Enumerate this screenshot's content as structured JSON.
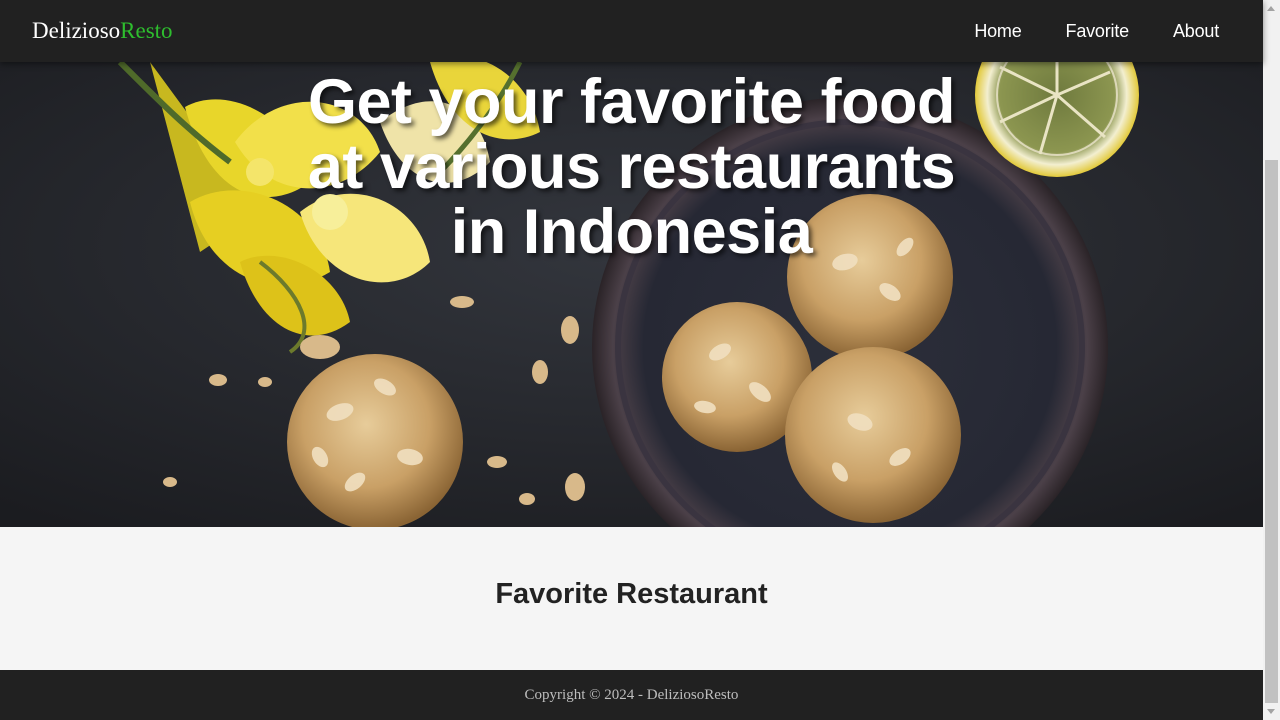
{
  "brand": {
    "name_main": "Delizioso",
    "name_accent": "Resto"
  },
  "nav": {
    "items": [
      {
        "label": "Home"
      },
      {
        "label": "Favorite"
      },
      {
        "label": "About"
      }
    ]
  },
  "hero": {
    "title_lines": [
      "Get your favorite food",
      "at various restaurants",
      "in Indonesia"
    ]
  },
  "main": {
    "section_title": "Favorite Restaurant"
  },
  "footer": {
    "copyright": "Copyright © 2024 - DeliziosoResto"
  },
  "colors": {
    "nav_bg": "#212121",
    "brand_accent": "#2ebd2e",
    "page_bg": "#f5f5f5",
    "footer_text": "#bdbdbd"
  }
}
